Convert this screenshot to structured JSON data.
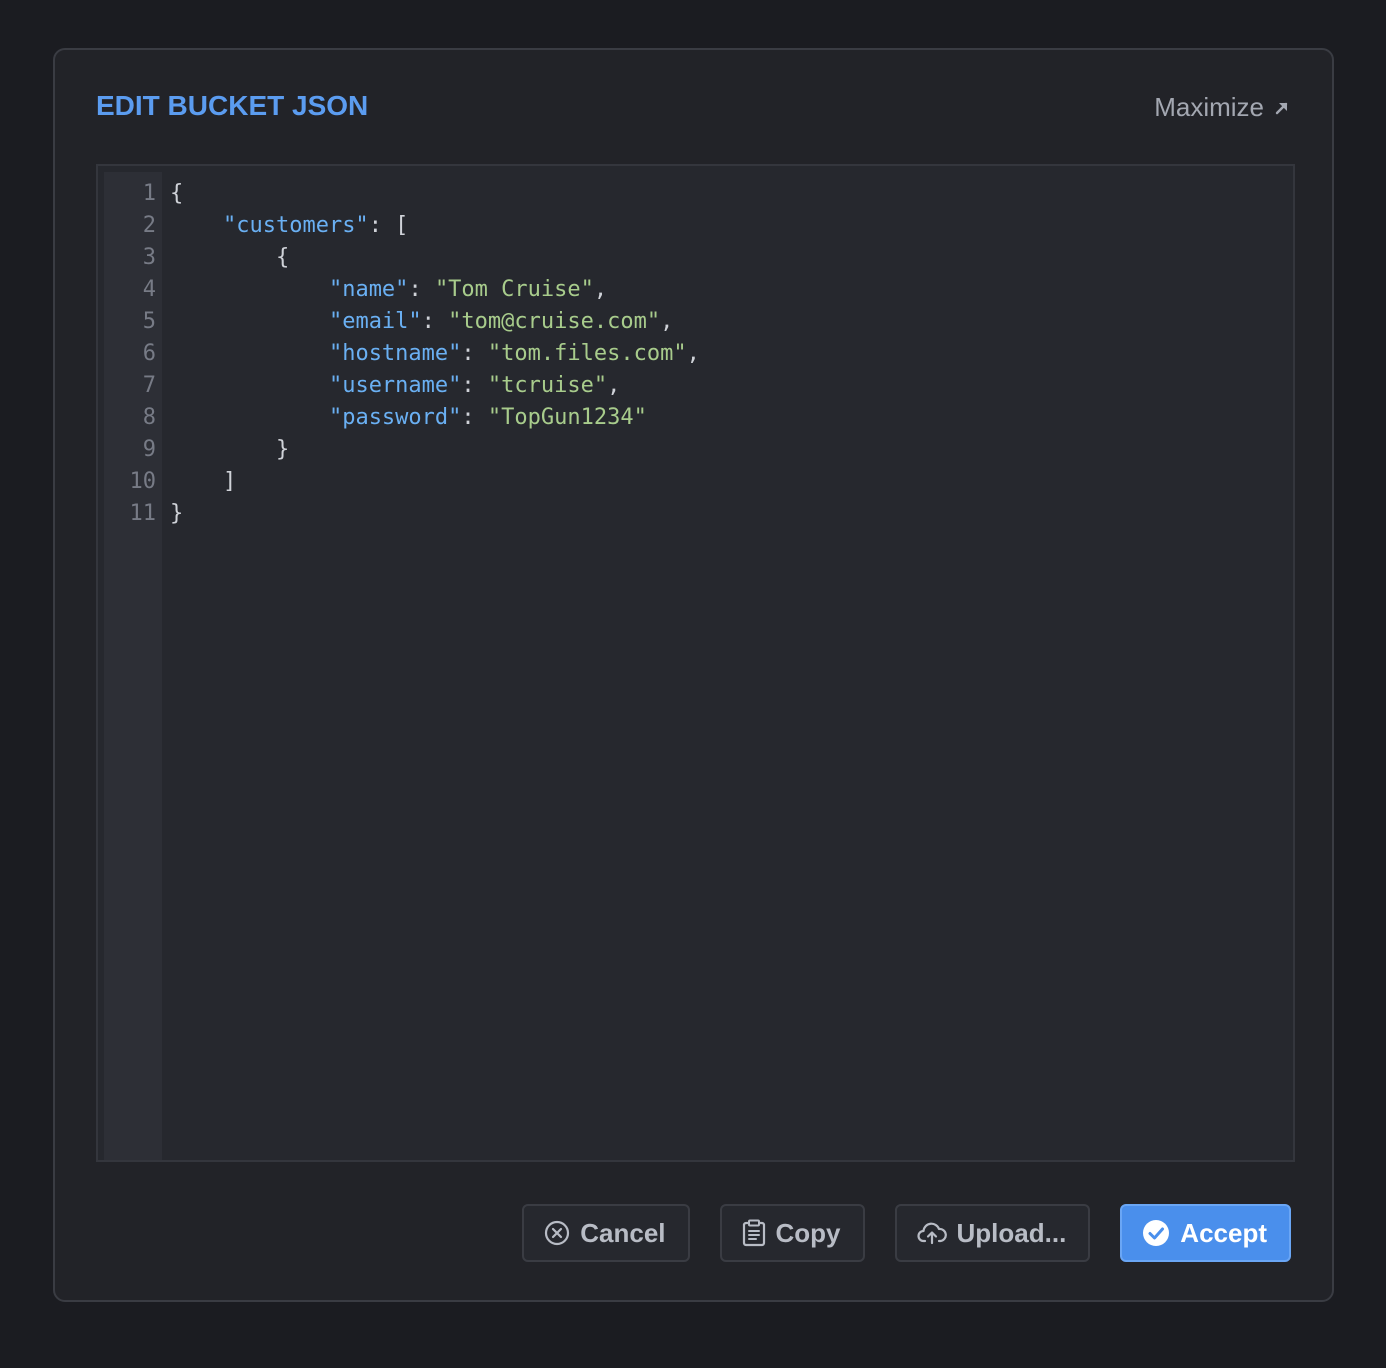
{
  "dialog": {
    "title": "EDIT BUCKET JSON",
    "maximize_label": "Maximize",
    "maximize_icon": "arrow-up-right-icon"
  },
  "editor": {
    "line_numbers": [
      "1",
      "2",
      "3",
      "4",
      "5",
      "6",
      "7",
      "8",
      "9",
      "10",
      "11"
    ],
    "lines": [
      [
        {
          "t": "{",
          "c": "punc"
        }
      ],
      [
        {
          "t": "    ",
          "c": "punc"
        },
        {
          "t": "\"customers\"",
          "c": "key"
        },
        {
          "t": ": [",
          "c": "punc"
        }
      ],
      [
        {
          "t": "        {",
          "c": "punc"
        }
      ],
      [
        {
          "t": "            ",
          "c": "punc"
        },
        {
          "t": "\"name\"",
          "c": "key"
        },
        {
          "t": ": ",
          "c": "punc"
        },
        {
          "t": "\"Tom Cruise\"",
          "c": "str"
        },
        {
          "t": ",",
          "c": "punc"
        }
      ],
      [
        {
          "t": "            ",
          "c": "punc"
        },
        {
          "t": "\"email\"",
          "c": "key"
        },
        {
          "t": ": ",
          "c": "punc"
        },
        {
          "t": "\"tom@cruise.com\"",
          "c": "str"
        },
        {
          "t": ",",
          "c": "punc"
        }
      ],
      [
        {
          "t": "            ",
          "c": "punc"
        },
        {
          "t": "\"hostname\"",
          "c": "key"
        },
        {
          "t": ": ",
          "c": "punc"
        },
        {
          "t": "\"tom.files.com\"",
          "c": "str"
        },
        {
          "t": ",",
          "c": "punc"
        }
      ],
      [
        {
          "t": "            ",
          "c": "punc"
        },
        {
          "t": "\"username\"",
          "c": "key"
        },
        {
          "t": ": ",
          "c": "punc"
        },
        {
          "t": "\"tcruise\"",
          "c": "str"
        },
        {
          "t": ",",
          "c": "punc"
        }
      ],
      [
        {
          "t": "            ",
          "c": "punc"
        },
        {
          "t": "\"password\"",
          "c": "key"
        },
        {
          "t": ": ",
          "c": "punc"
        },
        {
          "t": "\"TopGun1234\"",
          "c": "str"
        }
      ],
      [
        {
          "t": "        }",
          "c": "punc"
        }
      ],
      [
        {
          "t": "    ]",
          "c": "punc"
        }
      ],
      [
        {
          "t": "}",
          "c": "punc"
        }
      ]
    ]
  },
  "footer": {
    "cancel_label": "Cancel",
    "copy_label": "Copy",
    "upload_label": "Upload...",
    "accept_label": "Accept"
  },
  "colors": {
    "accent": "#5b9cf0",
    "accept_button": "#4a8fec",
    "json_key": "#6ab0f3",
    "json_string": "#a8cc8c"
  }
}
